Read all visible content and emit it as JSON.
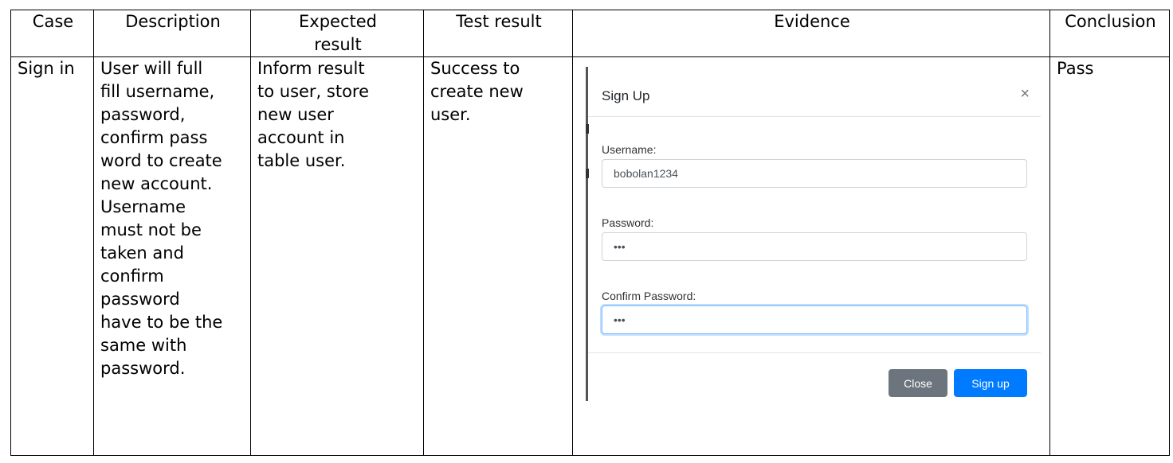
{
  "table": {
    "headers": {
      "case": "Case",
      "description": "Description",
      "expected_line1": "Expected",
      "expected_line2": "result",
      "test_result": "Test result",
      "evidence": "Evidence",
      "conclusion": "Conclusion"
    },
    "row": {
      "case": "Sign in",
      "description_lines": [
        "User will full",
        "fill username,",
        "password,",
        "confirm pass",
        "word to create",
        "new account.",
        "Username",
        "must not be",
        "taken and",
        "confirm",
        "password",
        "have to be the",
        "same with",
        "password."
      ],
      "expected_lines": [
        "Inform result",
        "to user, store",
        "new user",
        "account in",
        "table user."
      ],
      "test_result_lines": [
        "Success to",
        "create new",
        "user."
      ],
      "conclusion": "Pass"
    }
  },
  "modal": {
    "title": "Sign Up",
    "close_glyph": "×",
    "username_label": "Username:",
    "username_value": "bobolan1234",
    "password_label": "Password:",
    "password_value": "•••",
    "confirm_label": "Confirm Password:",
    "confirm_value": "•••",
    "close_button": "Close",
    "signup_button": "Sign up"
  }
}
